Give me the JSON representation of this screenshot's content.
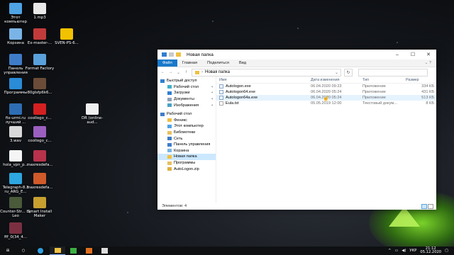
{
  "desktop": {
    "icons": [
      {
        "label": "Этот компьютер",
        "color": "#4fa3e3"
      },
      {
        "label": "1.mp3",
        "color": "#e8e8e8"
      },
      {
        "label": "Корзина",
        "color": "#7ab4e6"
      },
      {
        "label": "Ex-master-...",
        "color": "#c23b3b"
      },
      {
        "label": "SVEN-PS-6...",
        "color": "#f2c200"
      },
      {
        "label": "Панель управления",
        "color": "#3f7cc8"
      },
      {
        "label": "Format Factory",
        "color": "#5aa0db"
      },
      {
        "label": "Программы",
        "color": "#2a8bd6"
      },
      {
        "label": "80glsfp6k6...",
        "color": "#6b4c38"
      },
      {
        "label": "fix-urmi.ru лучший ...",
        "color": "#2e6db3"
      },
      {
        "label": "coollogo_c...",
        "color": "#d42020"
      },
      {
        "label": "DR (online-aud...",
        "color": "#f0f0f0"
      },
      {
        "label": "3.wav",
        "color": "#d9d9d9"
      },
      {
        "label": "coollogo_c...",
        "color": "#9b5fc0"
      },
      {
        "label": "hola_vpn_p...",
        "color": "#f5f5f5"
      },
      {
        "label": "maxresdefa...",
        "color": "#b8324b"
      },
      {
        "label": "Telegraph-8.3 ru_ARG_E...",
        "color": "#2ea6e0"
      },
      {
        "label": "maxresdefa...",
        "color": "#d05a2a"
      },
      {
        "label": "Counter-Str... by Leo",
        "color": "#4a5a3a"
      },
      {
        "label": "Smart Install Maker",
        "color": "#c8a030"
      },
      {
        "label": "fff_0(34_4...",
        "color": "#7a3040"
      }
    ]
  },
  "window": {
    "title": "Новая папка",
    "ribbon": [
      "Файл",
      "Главная",
      "Поделиться",
      "Вид"
    ],
    "address_path": "Новая папка",
    "nav_items": [
      {
        "label": "Быстрый доступ",
        "pinned": false,
        "sub": false,
        "color": "#2f7fd0",
        "selected": false
      },
      {
        "label": "Рабочий стол",
        "pinned": true,
        "sub": true,
        "color": "#3fb0c8",
        "selected": false
      },
      {
        "label": "Загрузки",
        "pinned": true,
        "sub": true,
        "color": "#2f7fd0",
        "selected": false
      },
      {
        "label": "Документы",
        "pinned": true,
        "sub": true,
        "color": "#8fa0b8",
        "selected": false
      },
      {
        "label": "Изображения",
        "pinned": true,
        "sub": true,
        "color": "#4aa0c8",
        "selected": false
      },
      {
        "label": "Рабочий стол",
        "pinned": false,
        "sub": false,
        "color": "#3f7cc8",
        "selected": false
      },
      {
        "label": "Феникс",
        "pinned": false,
        "sub": true,
        "color": "#f0c040",
        "selected": false
      },
      {
        "label": "Этот компьютер",
        "pinned": false,
        "sub": true,
        "color": "#4fa3e3",
        "selected": false
      },
      {
        "label": "Библиотеки",
        "pinned": false,
        "sub": true,
        "color": "#e8c060",
        "selected": false
      },
      {
        "label": "Сеть",
        "pinned": false,
        "sub": true,
        "color": "#3f7cc8",
        "selected": false
      },
      {
        "label": "Панель управления",
        "pinned": false,
        "sub": true,
        "color": "#3f7cc8",
        "selected": false
      },
      {
        "label": "Корзина",
        "pinned": false,
        "sub": true,
        "color": "#7ab4e6",
        "selected": false
      },
      {
        "label": "Новая папка",
        "pinned": false,
        "sub": true,
        "color": "#f0c040",
        "selected": true
      },
      {
        "label": "Программы",
        "pinned": false,
        "sub": true,
        "color": "#e8c060",
        "selected": false
      },
      {
        "label": "AutoLogon.zip",
        "pinned": false,
        "sub": true,
        "color": "#e0b040",
        "selected": false
      }
    ],
    "columns": [
      "Имя",
      "Дата изменения",
      "Тип",
      "Размер"
    ],
    "files": [
      {
        "name": "Autologon.exe",
        "date": "06.04.2020 09:23",
        "type": "Приложение",
        "size": "334 КБ"
      },
      {
        "name": "Autologon64.exe",
        "date": "06.04.2020 05:24",
        "type": "Приложение",
        "size": "431 КБ"
      },
      {
        "name": "Autologon64a.exe",
        "date": "06.04.2020 05:24",
        "type": "Приложение",
        "size": "513 КБ"
      },
      {
        "name": "Eula.txt",
        "date": "05.05.2019 12:00",
        "type": "Текстовый докум...",
        "size": "8 КБ"
      }
    ],
    "status": "Элементов: 4"
  },
  "taskbar": {
    "lang": "УКР",
    "time": "21:12",
    "date": "05.12.2020"
  }
}
